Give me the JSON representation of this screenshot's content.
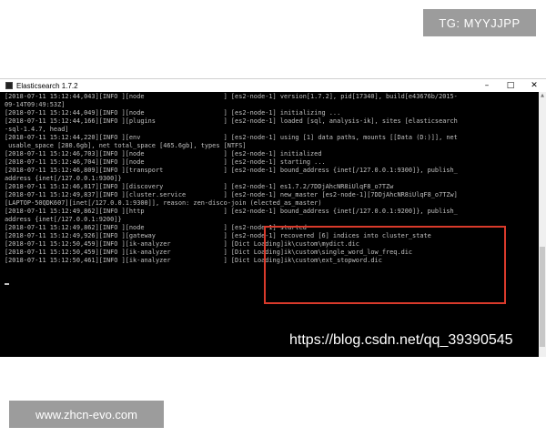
{
  "overlay_top": "TG: MYYJJPP",
  "overlay_bottom": "www.zhcn-evo.com",
  "watermark": "https://blog.csdn.net/qq_39390545",
  "window": {
    "title": "Elasticsearch 1.7.2",
    "minimize": "–",
    "maximize": "□",
    "close": "✕"
  },
  "console": {
    "lines": [
      "[2018-07-11 15:12:44,043][INFO ][node                     ] [es2-node-1] version[1.7.2], pid[17340], build[e43676b/2015-",
      "09-14T09:49:53Z]",
      "[2018-07-11 15:12:44,049][INFO ][node                     ] [es2-node-1] initializing ...",
      "[2018-07-11 15:12:44,166][INFO ][plugins                  ] [es2-node-1] loaded [sql, analysis-ik], sites [elasticsearch",
      "-sql-1.4.7, head]",
      "[2018-07-11 15:12:44,220][INFO ][env                      ] [es2-node-1] using [1] data paths, mounts [[Data (D:)]], net",
      " usable_space [280.6gb], net total_space [465.6gb], types [NTFS]",
      "[2018-07-11 15:12:46,703][INFO ][node                     ] [es2-node-1] initialized",
      "[2018-07-11 15:12:46,704][INFO ][node                     ] [es2-node-1] starting ...",
      "[2018-07-11 15:12:46,809][INFO ][transport                ] [es2-node-1] bound_address {inet[/127.0.0.1:9300]}, publish_",
      "address {inet[/127.0.0.1:9300]}",
      "[2018-07-11 15:12:46,817][INFO ][discovery                ] [es2-node-1] es1.7.2/7DDjAhcNR8iUlqF8_o7TZw",
      "[2018-07-11 15:12:49,837][INFO ][cluster.service          ] [es2-node-1] new_master [es2-node-1][7DDjAhcNR8iUlqF8_o7TZw]",
      "[LAPTOP-50QDK607][inet[/127.0.0.1:9300]], reason: zen-disco-join (elected_as_master)",
      "[2018-07-11 15:12:49,862][INFO ][http                     ] [es2-node-1] bound_address {inet[/127.0.0.1:9200]}, publish_",
      "address {inet[/127.0.0.1:9200]}",
      "[2018-07-11 15:12:49,862][INFO ][node                     ] [es2-node-1] started",
      "[2018-07-11 15:12:49,926][INFO ][gateway                  ] [es2-node-1] recovered [6] indices into cluster_state",
      "[2018-07-11 15:12:50,459][INFO ][ik-analyzer              ] [Dict Loading]ik\\custom\\mydict.dic",
      "[2018-07-11 15:12:50,459][INFO ][ik-analyzer              ] [Dict Loading]ik\\custom\\single_word_low_freq.dic",
      "[2018-07-11 15:12:50,461][INFO ][ik-analyzer              ] [Dict Loading]ik\\custom\\ext_stopword.dic"
    ]
  },
  "colors": {
    "console_bg": "#000000",
    "console_text": "#c0c0c0",
    "highlight_border": "#d93a2b",
    "badge_bg": "#9c9c9c"
  }
}
